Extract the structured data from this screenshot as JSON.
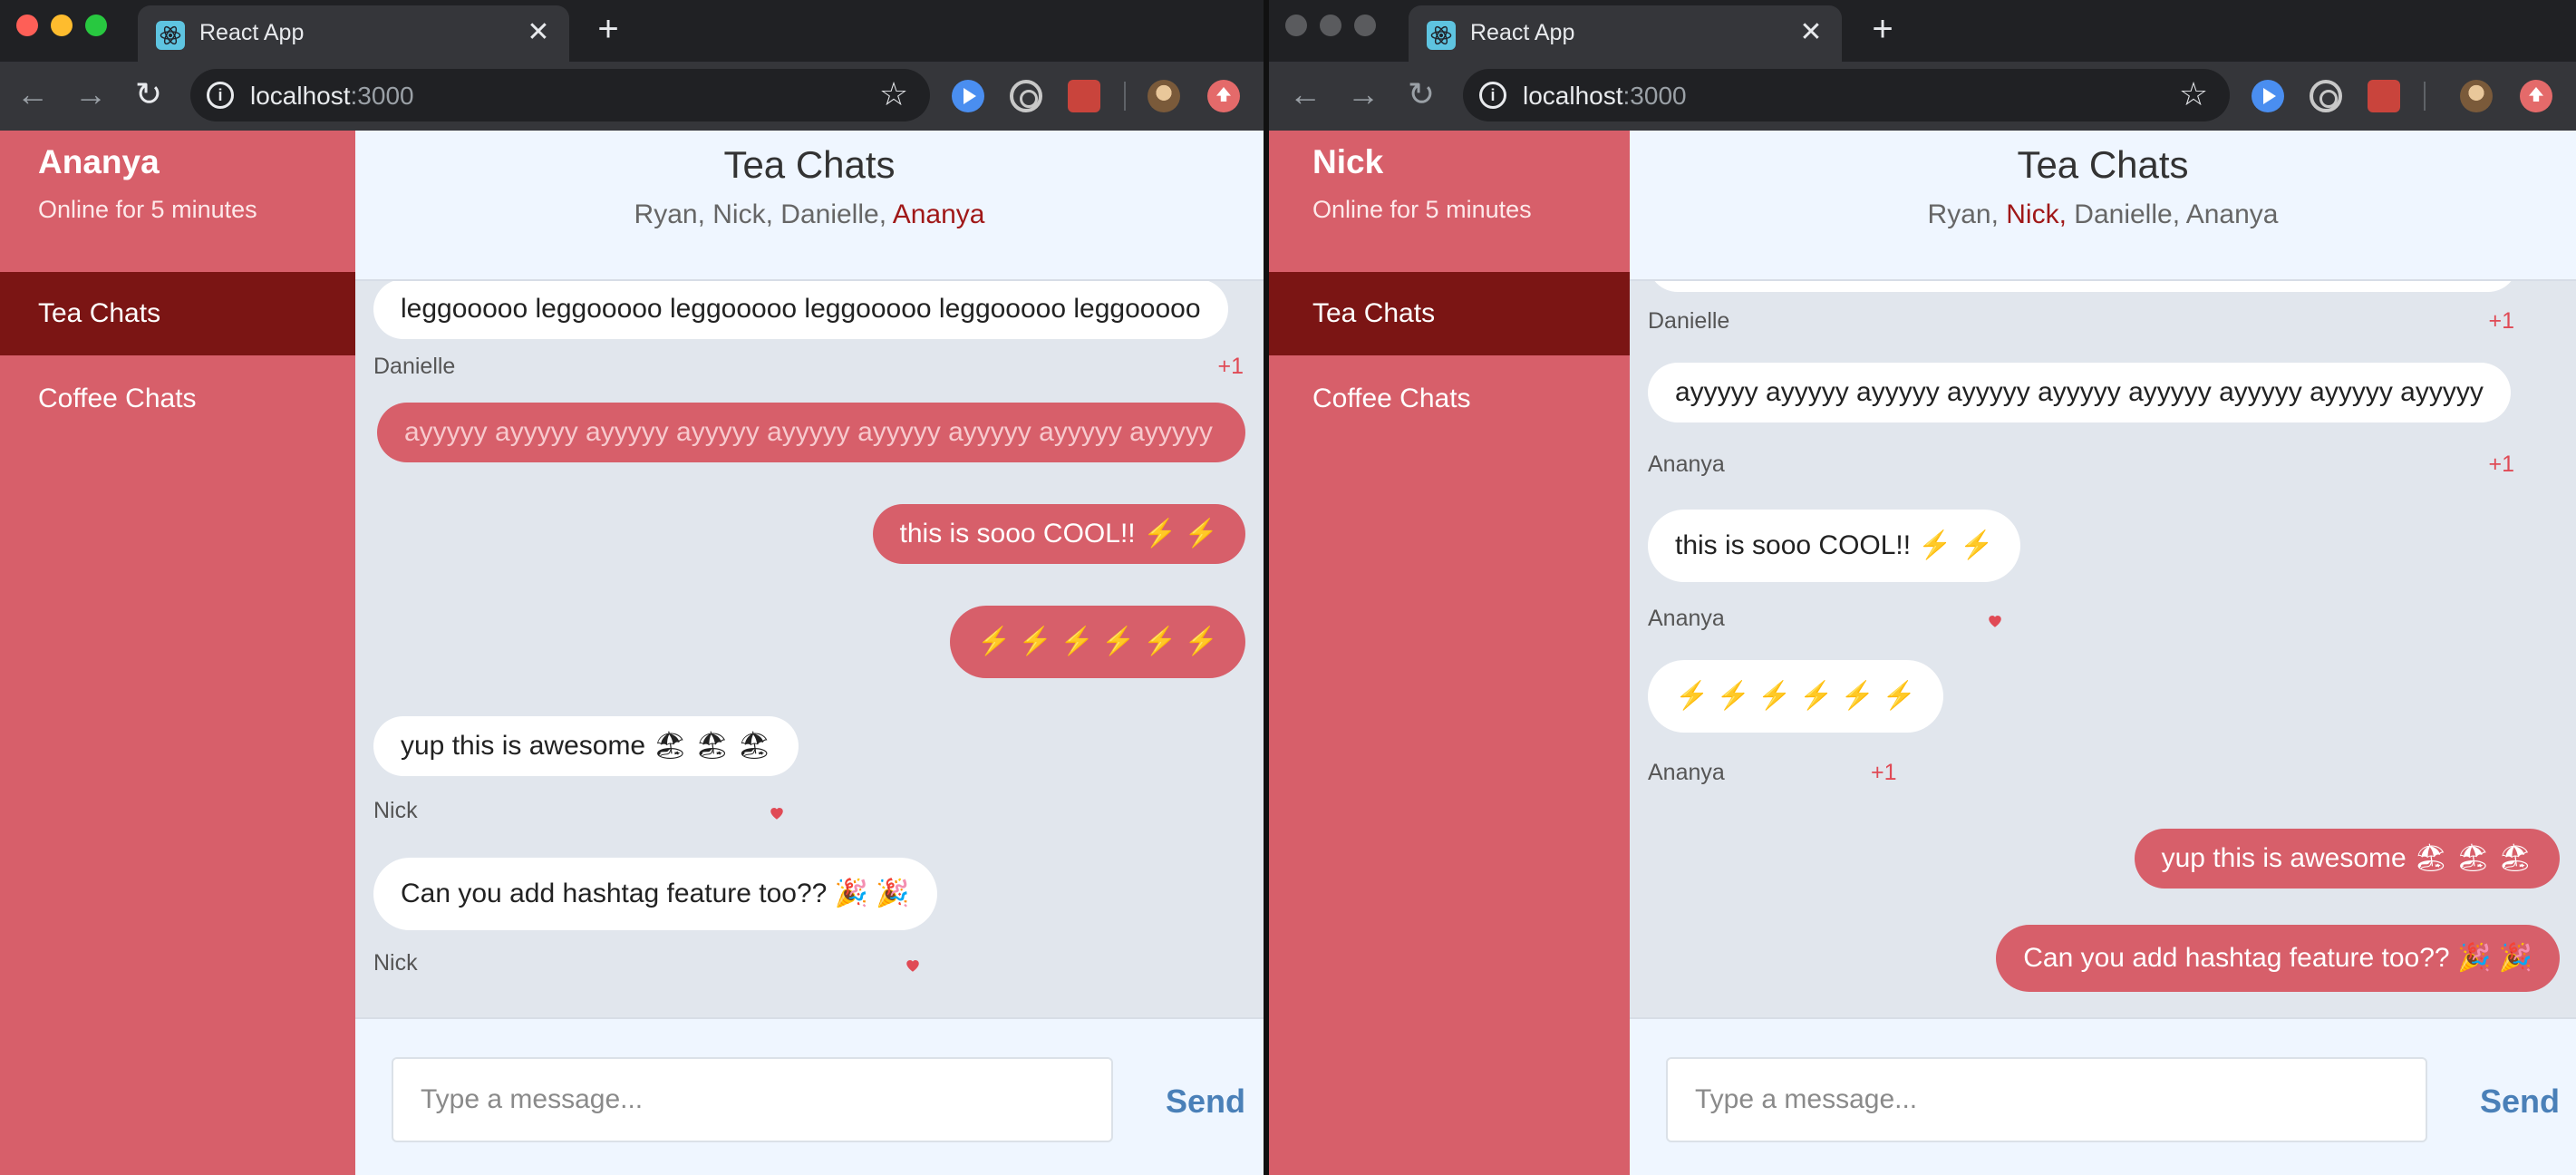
{
  "browser": {
    "tab_title": "React App",
    "tab_close": "✕",
    "new_tab": "+",
    "url_host": "localhost",
    "url_port": ":3000",
    "back_icon": "←",
    "forward_icon": "→",
    "reload_icon": "↻",
    "star_icon": "☆",
    "info_icon": "i"
  },
  "room_title": "Tea Chats",
  "member_sep": ", ",
  "rooms": [
    "Tea Chats",
    "Coffee Chats"
  ],
  "members": [
    "Ryan",
    "Nick",
    "Danielle",
    "Ananya"
  ],
  "composer": {
    "placeholder": "Type a message...",
    "send_label": "Send"
  },
  "left": {
    "user_name": "Ananya",
    "status": "Online for 5 minutes",
    "messages": [
      {
        "text": "leggooooo leggooooo leggooooo leggooooo leggooooo leggooooo",
        "mine": false
      },
      {
        "sender": "Danielle",
        "reaction": "+1"
      },
      {
        "text": "ayyyyy ayyyyy ayyyyy ayyyyy ayyyyy ayyyyy ayyyyy ayyyyy ayyyyy",
        "mine": true
      },
      {
        "text": "this is sooo COOL!! ⚡ ⚡",
        "mine": true
      },
      {
        "text": "⚡ ⚡ ⚡ ⚡ ⚡ ⚡",
        "mine": true
      },
      {
        "text": "yup this is awesome 🏖 🏖 🏖",
        "mine": false,
        "sender": "Nick",
        "heart": true
      },
      {
        "text": "Can you add hashtag feature too?? 🎉 🎉",
        "mine": false,
        "sender": "Nick",
        "heart": true
      }
    ]
  },
  "right": {
    "user_name": "Nick",
    "status": "Online for 5 minutes",
    "messages": [
      {
        "sender": "Danielle",
        "reaction": "+1"
      },
      {
        "text": "ayyyyy ayyyyy ayyyyy ayyyyy ayyyyy ayyyyy ayyyyy ayyyyy ayyyyy",
        "mine": false,
        "sender": "Ananya",
        "reaction": "+1"
      },
      {
        "text": "this is sooo COOL!! ⚡ ⚡",
        "mine": false,
        "sender": "Ananya",
        "heart": true
      },
      {
        "text": "⚡ ⚡ ⚡ ⚡ ⚡ ⚡",
        "mine": false,
        "sender": "Ananya",
        "reaction": "+1"
      },
      {
        "text": "yup this is awesome 🏖 🏖 🏖",
        "mine": true
      },
      {
        "text": "Can you add hashtag feature too?? 🎉 🎉",
        "mine": true
      }
    ]
  },
  "colors": {
    "sidebar": "#d75f6a",
    "active_room": "#7b1514",
    "header_bg": "#eff6ff",
    "message_area": "#e1e6ed",
    "send_text": "#4a80b8",
    "current_member": "#a01818"
  },
  "icons": {
    "tab_favicon": "react-logo-icon",
    "extensions": [
      "play-icon",
      "target-icon",
      "game-icon",
      "avatar-icon",
      "upload-icon"
    ],
    "heart": "heart-icon"
  }
}
